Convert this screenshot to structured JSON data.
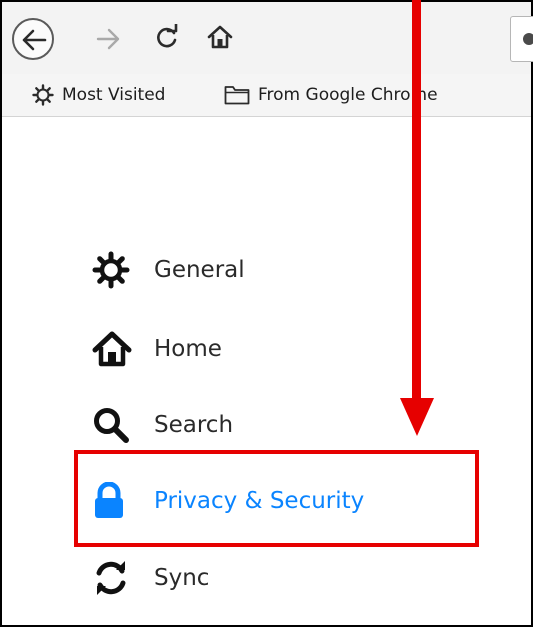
{
  "toolbar": {
    "back_icon": "back-arrow-icon",
    "forward_icon": "forward-arrow-icon",
    "reload_icon": "reload-icon",
    "home_icon": "home-icon"
  },
  "bookmarks": {
    "items": [
      {
        "label": "Most Visited",
        "icon": "gear-icon"
      },
      {
        "label": "From Google Chrome",
        "icon": "folder-icon"
      }
    ]
  },
  "sidebar": {
    "items": [
      {
        "label": "General",
        "icon": "gear-icon"
      },
      {
        "label": "Home",
        "icon": "home-icon"
      },
      {
        "label": "Search",
        "icon": "search-icon"
      },
      {
        "label": "Privacy & Security",
        "icon": "lock-icon",
        "selected": true
      },
      {
        "label": "Sync",
        "icon": "sync-icon"
      }
    ]
  },
  "colors": {
    "accent": "#0a84ff",
    "annotation": "#e60000"
  }
}
